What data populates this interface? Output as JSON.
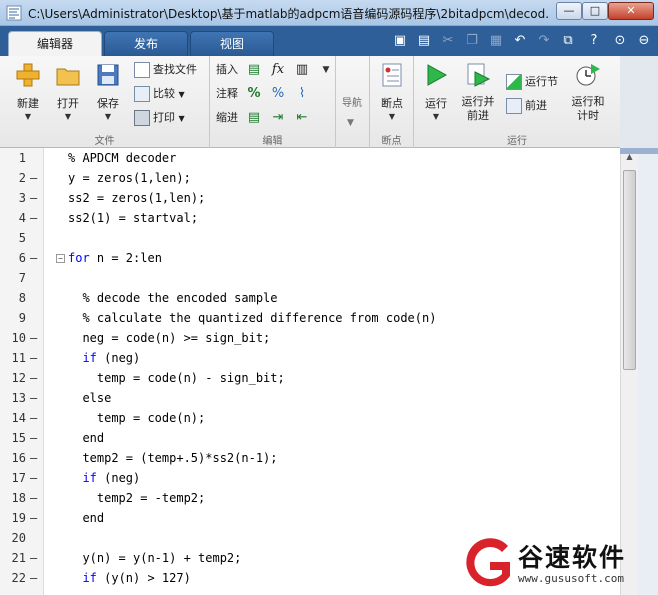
{
  "window": {
    "title": "C:\\Users\\Administrator\\Desktop\\基于matlab的adpcm语音编码源码程序\\2bitadpcm\\decod...",
    "min_label": "—",
    "max_label": "□",
    "close_label": "✕"
  },
  "tabs": [
    "编辑器",
    "发布",
    "视图"
  ],
  "ribbon": {
    "file_group": {
      "label": "文件",
      "new": "新建",
      "open": "打开",
      "save": "保存",
      "find_files": "查找文件",
      "compare": "比较",
      "print": "打印"
    },
    "edit_group": {
      "label": "编辑",
      "insert": "插入",
      "comment": "注释",
      "indent": "缩进"
    },
    "nav_group": {
      "label": "导航"
    },
    "breakpoint_group": {
      "label": "断点",
      "breakpoints": "断点"
    },
    "run_group": {
      "label": "运行",
      "run": "运行",
      "run_advance": "运行并\n前进",
      "run_section": "运行节",
      "advance": "前进",
      "run_time": "运行和\n计时"
    }
  },
  "code": {
    "lines": [
      {
        "n": "1",
        "mark": "",
        "indent": 0,
        "text": "% APDCM decoder",
        "kind": "comment"
      },
      {
        "n": "2",
        "mark": "—",
        "indent": 0,
        "text": "y = zeros(1,len);",
        "kind": "code"
      },
      {
        "n": "3",
        "mark": "—",
        "indent": 0,
        "text": "ss2 = zeros(1,len);",
        "kind": "code"
      },
      {
        "n": "4",
        "mark": "—",
        "indent": 0,
        "text": "ss2(1) = startval;",
        "kind": "code"
      },
      {
        "n": "5",
        "mark": "",
        "indent": 0,
        "text": "",
        "kind": "code"
      },
      {
        "n": "6",
        "mark": "—",
        "indent": 0,
        "text": "for n = 2:len",
        "kind": "for",
        "fold": true
      },
      {
        "n": "7",
        "mark": "",
        "indent": 0,
        "text": "",
        "kind": "code"
      },
      {
        "n": "8",
        "mark": "",
        "indent": 2,
        "text": "% decode the encoded sample",
        "kind": "comment"
      },
      {
        "n": "9",
        "mark": "",
        "indent": 2,
        "text": "% calculate the quantized difference from code(n)",
        "kind": "comment"
      },
      {
        "n": "10",
        "mark": "—",
        "indent": 2,
        "text": "neg = code(n) >= sign_bit;",
        "kind": "code"
      },
      {
        "n": "11",
        "mark": "—",
        "indent": 2,
        "text": "if (neg)",
        "kind": "if"
      },
      {
        "n": "12",
        "mark": "—",
        "indent": 4,
        "text": "temp = code(n) - sign_bit;",
        "kind": "code"
      },
      {
        "n": "13",
        "mark": "—",
        "indent": 2,
        "text": "else",
        "kind": "kw"
      },
      {
        "n": "14",
        "mark": "—",
        "indent": 4,
        "text": "temp = code(n);",
        "kind": "code"
      },
      {
        "n": "15",
        "mark": "—",
        "indent": 2,
        "text": "end",
        "kind": "kw"
      },
      {
        "n": "16",
        "mark": "—",
        "indent": 2,
        "text": "temp2 = (temp+.5)*ss2(n-1);",
        "kind": "code"
      },
      {
        "n": "17",
        "mark": "—",
        "indent": 2,
        "text": "if (neg)",
        "kind": "if"
      },
      {
        "n": "18",
        "mark": "—",
        "indent": 4,
        "text": "temp2 = -temp2;",
        "kind": "code"
      },
      {
        "n": "19",
        "mark": "—",
        "indent": 2,
        "text": "end",
        "kind": "kw"
      },
      {
        "n": "20",
        "mark": "",
        "indent": 0,
        "text": "",
        "kind": "code"
      },
      {
        "n": "21",
        "mark": "—",
        "indent": 2,
        "text": "y(n) = y(n-1) + temp2;",
        "kind": "code"
      },
      {
        "n": "22",
        "mark": "—",
        "indent": 2,
        "text": "if (y(n) > 127)",
        "kind": "if"
      }
    ]
  },
  "watermark": {
    "cn": "谷速软件",
    "url": "www.gususoft.com"
  },
  "colors": {
    "comment": "#228b22",
    "keyword": "#0000ff",
    "tab_bar": "#2e5f99",
    "run_green": "#1e9e32"
  }
}
